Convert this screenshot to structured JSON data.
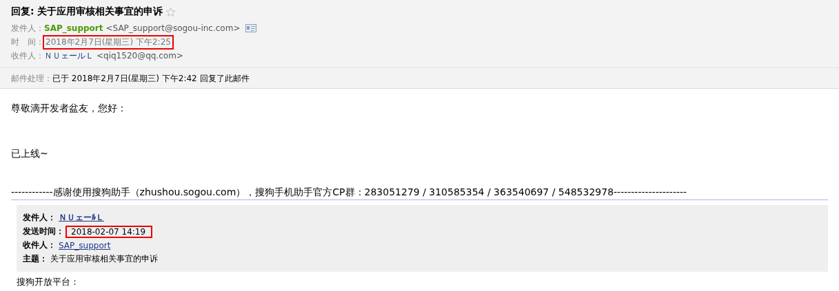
{
  "header": {
    "title": "回复: 关于应用审核相关事宜的申诉",
    "starred": false,
    "fields": [
      {
        "kind": "sender",
        "label": "发件人：",
        "name": "SAP_support",
        "address": "<SAP_support@sogou-inc.com>",
        "highlighted": false
      },
      {
        "kind": "time",
        "label": "时　间：",
        "value": "2018年2月7日(星期三) 下午2:25",
        "highlighted": true
      },
      {
        "kind": "recipient",
        "label": "收件人：",
        "name": "ＮＵェールＬ",
        "address": "<qiq1520@qq.com>",
        "highlighted": false
      }
    ],
    "status": {
      "label": "邮件处理：",
      "value": "已于 2018年2月7日(星期三) 下午2:42 回复了此邮件"
    }
  },
  "body": {
    "paragraphs": [
      "尊敬滴开发者盆友，您好：",
      "已上线~"
    ],
    "signature": "------------感谢使用搜狗助手（zhushou.sogou.com），搜狗手机助手官方CP群：283051279 / 310585354 / 363540697 / 548532978---------------------"
  },
  "quote": {
    "fields": [
      {
        "kind": "link",
        "label": "发件人：",
        "value": "ＮＵェーﾙＬ",
        "highlighted": false
      },
      {
        "kind": "text",
        "label": "发送时间：",
        "value": "2018-02-07 14:19",
        "highlighted": true
      },
      {
        "kind": "link",
        "label": "收件人：",
        "value": "SAP_support",
        "highlighted": false
      },
      {
        "kind": "text",
        "label": "主题：",
        "value": "关于应用审核相关事宜的申诉",
        "highlighted": false
      }
    ],
    "after": "搜狗开放平台："
  }
}
